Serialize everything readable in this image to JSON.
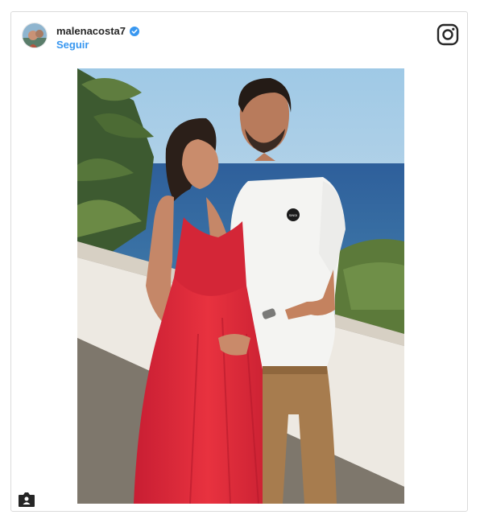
{
  "post": {
    "username": "malenacosta7",
    "follow_label": "Seguir",
    "verified": true
  },
  "icons": {
    "avatar": "profile-photo",
    "verified": "verified-badge-icon",
    "brand": "instagram-icon",
    "tag": "user-tag-icon"
  },
  "photo": {
    "tshirt_text": "SINDI"
  },
  "colors": {
    "link": "#3897f0",
    "text": "#262626",
    "border": "#dbdbdb",
    "dress": "#e8323f"
  }
}
